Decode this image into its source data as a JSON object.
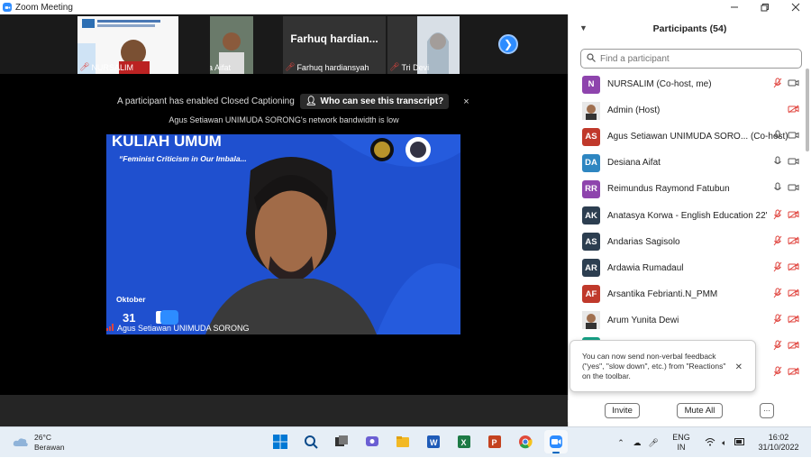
{
  "window": {
    "title": "Zoom Meeting"
  },
  "strip": {
    "tiles": [
      {
        "name": "NURSALIM"
      },
      {
        "name": "Desiana Aifat"
      },
      {
        "name": "Farhuq hardiansyah",
        "big_label": "Farhuq  hardian..."
      },
      {
        "name": "Tri Devi"
      }
    ]
  },
  "banner": {
    "cc_text": "A participant has enabled Closed Captioning",
    "cc_button": "Who can see this transcript?",
    "close": "×",
    "bandwidth": "Agus Setiawan UNIMUDA SORONG's network bandwidth is low"
  },
  "speaker": {
    "name": "Agus Setiawan UNIMUDA SORONG",
    "slide_title": "KULIAH UMUM",
    "slide_subtitle": "“Feminist Criticism in Our Imbala...",
    "date_month": "Oktober",
    "date_day": "31"
  },
  "panel": {
    "title": "Participants (54)",
    "search_placeholder": "Find a participant",
    "participants": [
      {
        "initials": "N",
        "name": "NURSALIM (Co-host, me)",
        "color": "#8e44ad",
        "mic": "muted",
        "video": "on"
      },
      {
        "initials": "",
        "name": "Admin (Host)",
        "color": "#ccc",
        "mic": "none",
        "video": "off",
        "photo": true
      },
      {
        "initials": "AS",
        "name": "Agus Setiawan UNIMUDA SORO... (Co-host)",
        "color": "#c0392b",
        "mic": "on",
        "video": "on"
      },
      {
        "initials": "DA",
        "name": "Desiana Aifat",
        "color": "#2e86c1",
        "mic": "on",
        "video": "on"
      },
      {
        "initials": "RR",
        "name": "Reimundus Raymond Fatubun",
        "color": "#8e44ad",
        "mic": "on",
        "video": "on"
      },
      {
        "initials": "AK",
        "name": "Anatasya Korwa - English Education 22'",
        "color": "#2c3e50",
        "mic": "muted",
        "video": "off"
      },
      {
        "initials": "AS",
        "name": "Andarias Sagisolo",
        "color": "#2c3e50",
        "mic": "muted",
        "video": "off"
      },
      {
        "initials": "AR",
        "name": "Ardawia Rumadaul",
        "color": "#2c3e50",
        "mic": "muted",
        "video": "off"
      },
      {
        "initials": "AF",
        "name": "Arsantika Febrianti.N_PMM",
        "color": "#c0392b",
        "mic": "muted",
        "video": "off"
      },
      {
        "initials": "",
        "name": "Arum Yunita Dewi",
        "color": "#ccc",
        "mic": "muted",
        "video": "off",
        "photo": true
      },
      {
        "initials": "",
        "name": "",
        "color": "#16a085",
        "mic": "muted",
        "video": "off"
      },
      {
        "initials": "",
        "name": "",
        "color": "#2c3e50",
        "mic": "muted",
        "video": "off"
      }
    ],
    "toast": "You can now send non-verbal feedback (\"yes\", \"slow down\", etc.) from \"Reactions\" on the toolbar.",
    "invite": "Invite",
    "mute_all": "Mute All",
    "more": "···"
  },
  "taskbar": {
    "temp": "26°C",
    "weather": "Berawan",
    "lang_top": "ENG",
    "lang_bottom": "IN",
    "time": "16:02",
    "date": "31/10/2022"
  },
  "colors": {
    "zoom_blue": "#2d8cff",
    "muted_red": "#e0443e"
  }
}
